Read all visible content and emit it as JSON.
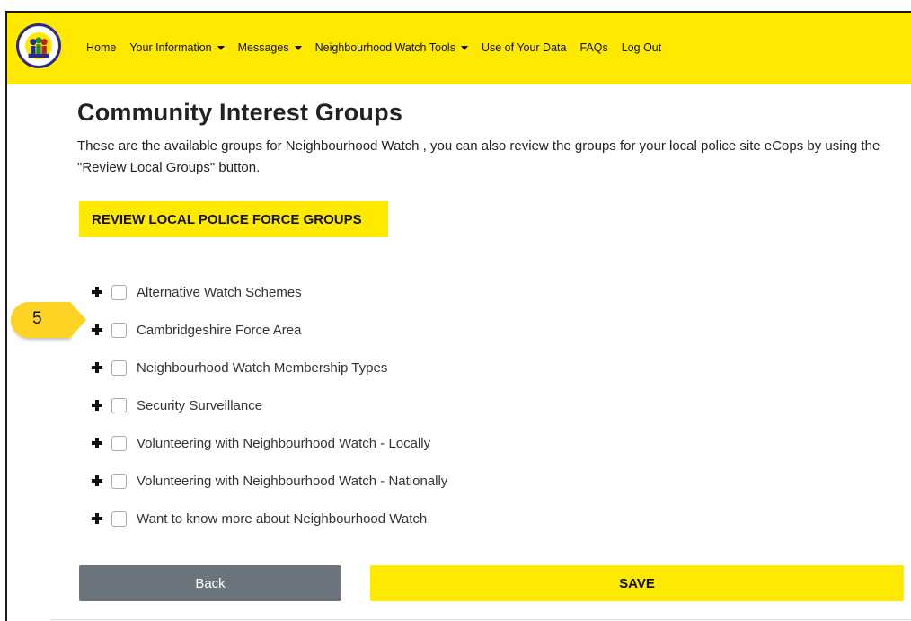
{
  "nav": {
    "items": [
      {
        "label": "Home",
        "dropdown": false
      },
      {
        "label": "Your Information",
        "dropdown": true
      },
      {
        "label": "Messages",
        "dropdown": true
      },
      {
        "label": "Neighbourhood Watch Tools",
        "dropdown": true
      },
      {
        "label": "Use of Your Data",
        "dropdown": false
      },
      {
        "label": "FAQs",
        "dropdown": false
      },
      {
        "label": "Log Out",
        "dropdown": false
      }
    ]
  },
  "page": {
    "title": "Community Interest Groups",
    "description": "These are the available groups for Neighbourhood Watch , you can also review the groups for your local police site eCops by using the \"Review Local Groups\" button.",
    "review_button": "REVIEW LOCAL POLICE FORCE GROUPS"
  },
  "groups": [
    {
      "label": "Alternative Watch Schemes",
      "checked": false
    },
    {
      "label": "Cambridgeshire Force Area",
      "checked": false
    },
    {
      "label": "Neighbourhood Watch Membership Types",
      "checked": false
    },
    {
      "label": "Security Surveillance",
      "checked": false
    },
    {
      "label": "Volunteering with Neighbourhood Watch - Locally",
      "checked": false
    },
    {
      "label": "Volunteering with Neighbourhood Watch - Nationally",
      "checked": false
    },
    {
      "label": "Want to know more about Neighbourhood Watch",
      "checked": false
    }
  ],
  "callout": {
    "number": "5"
  },
  "actions": {
    "back_label": "Back",
    "save_label": "SAVE"
  },
  "colors": {
    "brand_yellow": "#ffe900",
    "back_gray": "#6c757d",
    "callout_yellow": "#ffd324"
  }
}
